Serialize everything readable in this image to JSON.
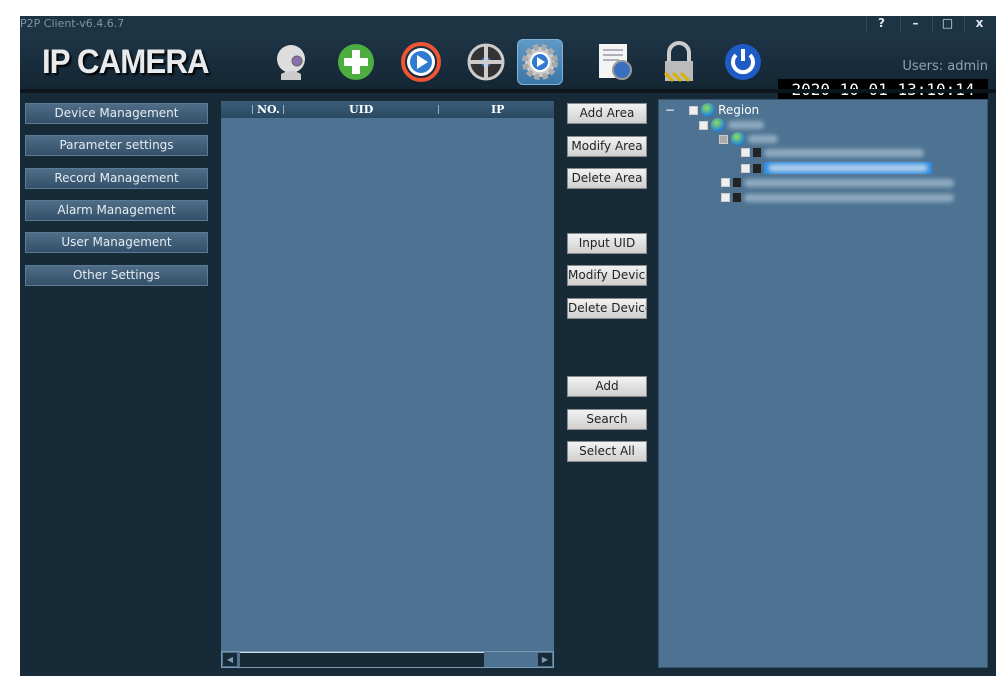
{
  "window": {
    "title": "P2P Client-v6.4.6.7",
    "help": "?",
    "minimize": "–",
    "maximize": "□",
    "close": "x"
  },
  "header": {
    "logo": "IP CAMERA",
    "user": "Users: admin",
    "datetime": "2020-10-01  13:10:14",
    "tools": [
      "camera-icon",
      "add-icon",
      "playback-icon",
      "ptz-icon",
      "settings-icon",
      "log-icon",
      "lock-icon",
      "power-icon"
    ],
    "active_tool": "settings-icon"
  },
  "sidebar": {
    "items": [
      "Device Management",
      "Parameter settings",
      "Record Management",
      "Alarm Management",
      "User Management",
      "Other Settings"
    ]
  },
  "list": {
    "columns": [
      "NO.",
      "UID",
      "IP"
    ]
  },
  "actions": {
    "add_area": "Add Area",
    "modify_area": "Modify Area",
    "delete_area": "Delete Area",
    "input_uid": "Input UID",
    "modify_device": "Modify Device",
    "delete_device": "Delete Device",
    "add": "Add",
    "search": "Search",
    "select_all": "Select All"
  },
  "tree": {
    "root": "Region"
  },
  "colors": {
    "bg": "#172a38",
    "panel": "#4e7392",
    "selected": "#2f8be0"
  }
}
